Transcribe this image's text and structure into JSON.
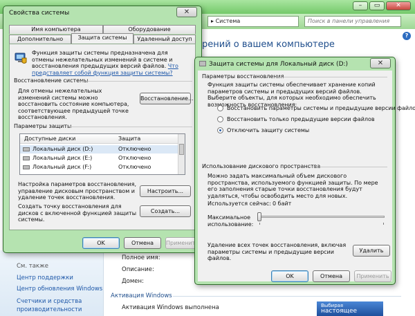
{
  "background_window": {
    "breadcrumb": "Система",
    "breadcrumb_sep": "▸",
    "search_placeholder": "Поиск в панели управления",
    "heading": "рений о вашем компьютере",
    "help": "?",
    "see_also": "См. также",
    "links": [
      "Центр поддержки",
      "Центр обновления Windows",
      "Счетчики и средства",
      "производительности"
    ],
    "info_labels": [
      "Полное имя:",
      "Описание:",
      "Домен:"
    ],
    "activation_header": "Активация Windows",
    "activation_status": "Активация Windows выполнена",
    "genuine_badge_line1": "Выбирая",
    "genuine_badge_line2": "настоящее"
  },
  "system_properties": {
    "title": "Свойства системы",
    "close_glyph": "✕",
    "tabs_top": [
      "Имя компьютера",
      "Оборудование"
    ],
    "tabs_bottom": [
      "Дополнительно",
      "Защита системы",
      "Удаленный доступ"
    ],
    "intro": "Функция защиты системы предназначена для отмены нежелательных изменений в системе и восстановления предыдущих версий файлов.",
    "intro_link": "Что представляет собой функция защиты системы?",
    "restore_group": "Восстановление системы",
    "restore_text": "Для отмены нежелательных изменений системы можно восстановить состояние компьютера, соответствующее предыдущей точке восстановления.",
    "restore_button": "Восстановление...",
    "params_group": "Параметры защиты",
    "columns": [
      "Доступные диски",
      "Защита"
    ],
    "drives": [
      {
        "name": "Локальный диск (D:)",
        "status": "Отключено"
      },
      {
        "name": "Локальный диск (E:)",
        "status": "Отключено"
      },
      {
        "name": "Локальный диск (F:)",
        "status": "Отключено"
      }
    ],
    "configure_text": "Настройка параметров восстановления, управление дисковым пространством и удаление точек восстановления.",
    "configure_button": "Настроить...",
    "create_text": "Создать точку восстановления для дисков с включенной функцией защиты системы.",
    "create_button": "Создать...",
    "ok": "OK",
    "cancel": "Отмена",
    "apply": "Применить"
  },
  "protection_dialog": {
    "title": "Защита системы для Локальный диск (D:)",
    "close_glyph": "✕",
    "restore_group": "Параметры восстановления",
    "restore_desc": "Функция защиты системы обеспечивает хранение копий параметров системы и предыдущих версий файлов. Выберите объекты, для которых необходимо обеспечить возможность восстановления:",
    "options": [
      "Восстановить параметры системы и предыдущие версии файлов",
      "Восстановить только предыдущие версии файлов",
      "Отключить защиту системы"
    ],
    "selected_option": 2,
    "disk_group": "Использование дискового пространства",
    "disk_desc": "Можно задать максимальный объем дискового пространства, используемого функцией защиты. По мере его заполнения старые точки восстановления будут удаляться, чтобы освободить место для новых.",
    "current_usage_label": "Используется сейчас:",
    "current_usage_value": "0 байт",
    "max_usage_label_1": "Максимальное",
    "max_usage_label_2": "использование:",
    "max_usage_fraction": 0,
    "delete_text": "Удаление всех точек восстановления, включая параметры системы и предыдущие версии файлов.",
    "delete_button": "Удалить",
    "ok": "OK",
    "cancel": "Отмена",
    "apply": "Применить"
  }
}
